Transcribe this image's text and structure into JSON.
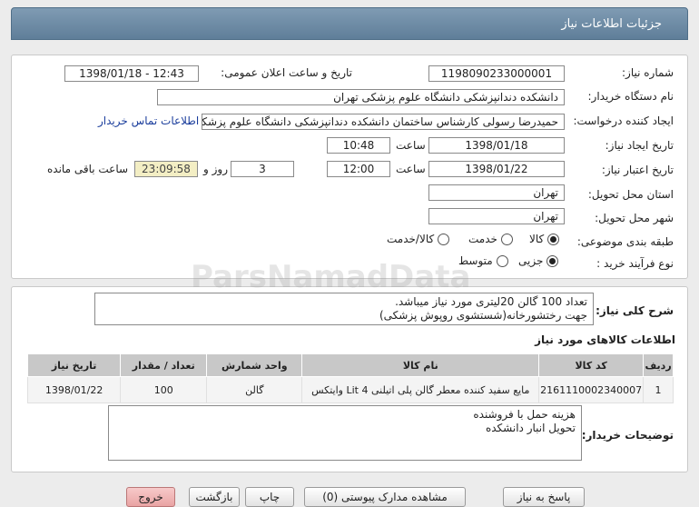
{
  "header": {
    "title": "جزئیات اطلاعات نیاز"
  },
  "form": {
    "need_number_label": "شماره نیاز:",
    "need_number": "1198090233000001",
    "announce_label": "تاریخ و ساعت اعلان عمومی:",
    "announce_value": "1398/01/18 - 12:43",
    "buyer_label": "نام دستگاه خریدار:",
    "buyer_value": "دانشکده دندانپزشکی دانشگاه علوم پزشکی تهران",
    "creator_label": "ایجاد کننده درخواست:",
    "creator_value": "حمیدرضا رسولی کارشناس ساختمان دانشکده دندانپزشکی دانشگاه علوم پزشکی تهران",
    "contact_link": "اطلاعات تماس خریدار",
    "created_date_label": "تاریخ ایجاد نیاز:",
    "created_date": "1398/01/18",
    "time_label": "ساعت",
    "created_time": "10:48",
    "validity_label": "تاریخ اعتبار نیاز:",
    "validity_date": "1398/01/22",
    "validity_time": "12:00",
    "days_value": "3",
    "days_label": "روز و",
    "remaining_value": "23:09:58",
    "remaining_label": "ساعت باقی مانده",
    "province_label": "استان محل تحویل:",
    "province_value": "تهران",
    "city_label": "شهر محل تحویل:",
    "city_value": "تهران",
    "category_label": "طبقه بندی موضوعی:",
    "category_options": [
      "کالا",
      "خدمت",
      "کالا/خدمت"
    ],
    "category_selected": "کالا",
    "process_label": "نوع فرآیند خرید :",
    "process_options": [
      "جزیی",
      "متوسط"
    ],
    "process_selected": "جزیی"
  },
  "summary": {
    "label": "شرح کلی نیاز:",
    "line1": "تعداد 100 گالن 20لیتری مورد نیاز میباشد.",
    "line2": "جهت رختشورخانه(شستشوی روپوش پزشکی)"
  },
  "items_section_title": "اطلاعات کالاهای مورد نیاز",
  "table": {
    "headers": [
      "ردیف",
      "کد کالا",
      "نام کالا",
      "واحد شمارش",
      "تعداد / مقدار",
      "تاریخ نیاز"
    ],
    "rows": [
      [
        "1",
        "2161110002340007",
        "مایع سفید کننده معطر گالن پلی اتیلنی 4 Lit وایتکس",
        "گالن",
        "100",
        "1398/01/22"
      ]
    ]
  },
  "buyer_notes": {
    "label": "توضیحات خریدار:",
    "line1": "هزینه حمل با فروشنده",
    "line2": "تحویل انبار دانشکده"
  },
  "watermark": "ParsNamadData",
  "buttons": {
    "reply": "پاسخ به نیاز",
    "view_docs": "مشاهده مدارک پیوستی (0)",
    "print": "چاپ",
    "back": "بازگشت",
    "exit": "خروج"
  }
}
